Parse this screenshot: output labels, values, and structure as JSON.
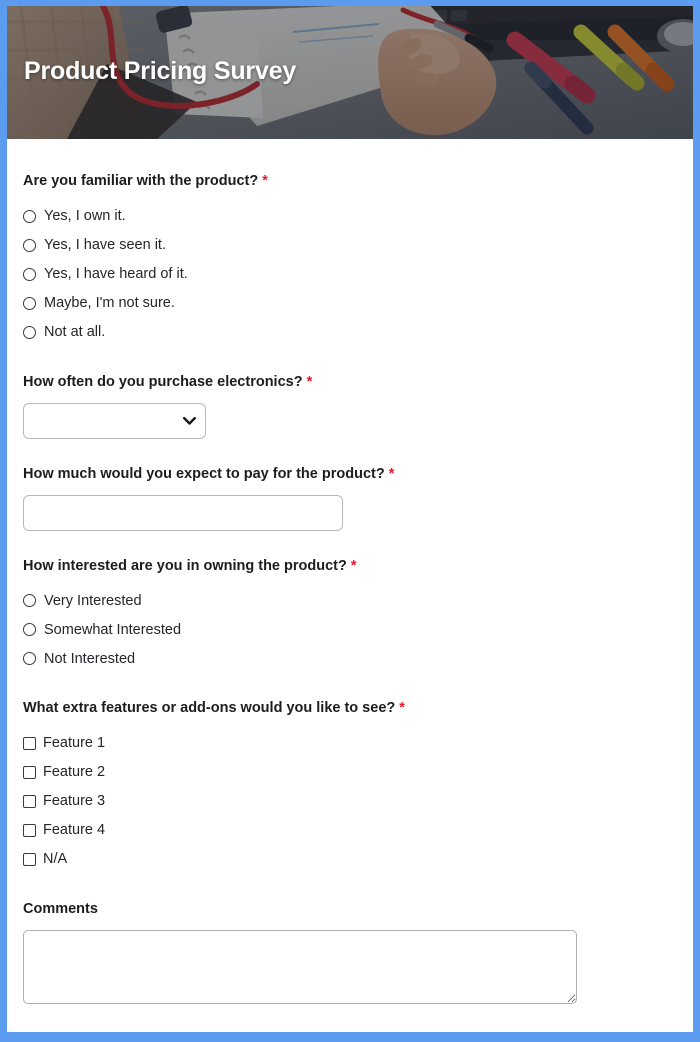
{
  "theme": {
    "frame_color": "#5b9bf0",
    "card_background": "#ffffff",
    "required_star_color": "#e8192c",
    "label_color": "#1d1d1f",
    "title_color": "#ffffff"
  },
  "header": {
    "title": "Product Pricing Survey",
    "image_alt": "Person writing in a notebook with a pen, colored markers and a keyboard on a gray desk"
  },
  "form": {
    "required_marker": "*",
    "questions": [
      {
        "id": "familiarity",
        "label": "Are you familiar with the product?",
        "required": true,
        "type": "radio",
        "options": [
          "Yes, I own it.",
          "Yes, I have seen it.",
          "Yes, I have heard of it.",
          "Maybe, I'm not sure.",
          "Not at all."
        ]
      },
      {
        "id": "purchase-frequency",
        "label": "How often do you purchase electronics?",
        "required": true,
        "type": "select",
        "value": "",
        "placeholder": "",
        "options": [
          ""
        ],
        "chevron_icon": "chevron-down-icon"
      },
      {
        "id": "expected-price",
        "label": "How much would you expect to pay for the product?",
        "required": true,
        "type": "text",
        "value": "",
        "placeholder": ""
      },
      {
        "id": "interest-level",
        "label": "How interested are you in owning the product?",
        "required": true,
        "type": "radio",
        "options": [
          "Very Interested",
          "Somewhat Interested",
          "Not Interested"
        ]
      },
      {
        "id": "extra-features",
        "label": "What extra features or add-ons would you like to see?",
        "required": true,
        "type": "checkbox",
        "options": [
          "Feature 1",
          "Feature 2",
          "Feature 3",
          "Feature 4",
          "N/A"
        ]
      },
      {
        "id": "comments",
        "label": "Comments",
        "required": false,
        "type": "textarea",
        "value": "",
        "placeholder": ""
      }
    ]
  }
}
